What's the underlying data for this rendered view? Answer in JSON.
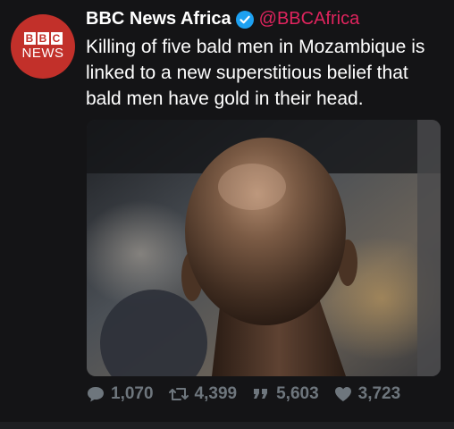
{
  "author": {
    "avatar_top": "BBC",
    "avatar_bottom": "NEWS",
    "display_name": "BBC News Africa",
    "handle": "@BBCAfrica",
    "verified": true
  },
  "tweet": {
    "text": "Killing of five bald men in Mozambique is linked to a new superstitious belief that bald men have gold in their head."
  },
  "media": {
    "alt": "photo of the back of a bald man's head"
  },
  "actions": {
    "replies": "1,070",
    "retweets": "4,399",
    "quotes": "5,603",
    "likes": "3,723"
  },
  "colors": {
    "background": "#141416",
    "brand_red": "#c2302a",
    "handle_pink": "#e0245e",
    "verified_blue": "#1da1f2",
    "action_gray": "#6e767d"
  },
  "icons": [
    "reply-icon",
    "retweet-icon",
    "quote-icon",
    "like-icon",
    "verified-badge-icon"
  ]
}
